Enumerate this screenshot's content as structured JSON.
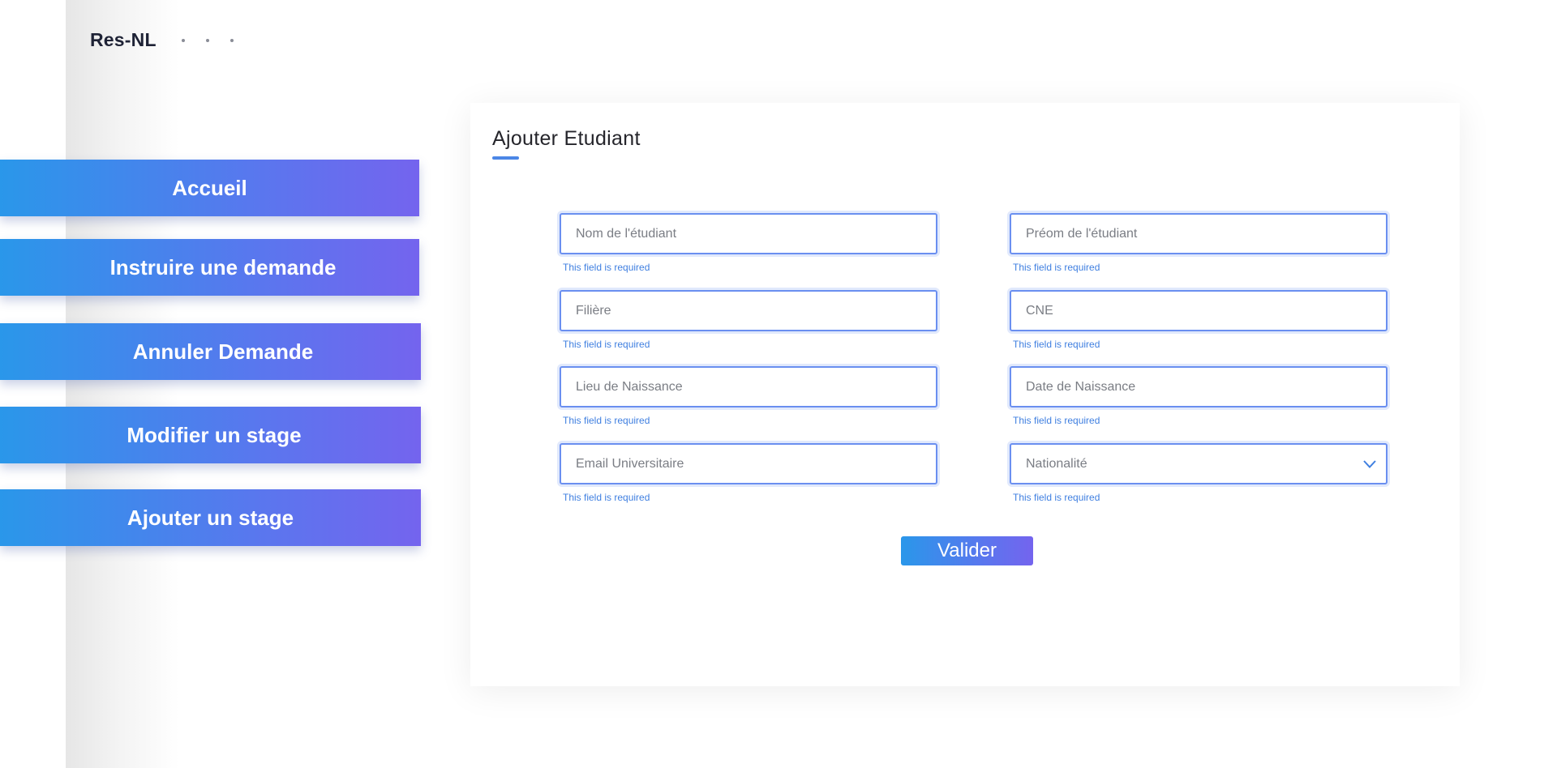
{
  "brand": "Res-NL",
  "nav": {
    "items": [
      {
        "label": "Accueil"
      },
      {
        "label": "Instruire une demande"
      },
      {
        "label": "Annuler Demande"
      },
      {
        "label": "Modifier un stage"
      },
      {
        "label": "Ajouter un stage"
      }
    ]
  },
  "form": {
    "title": "Ajouter Etudiant",
    "fields": [
      {
        "placeholder": "Nom de l'étudiant",
        "error": "This field is required"
      },
      {
        "placeholder": "Préom de l'étudiant",
        "error": "This field is required"
      },
      {
        "placeholder": "Filière",
        "error": "This field is required"
      },
      {
        "placeholder": "CNE",
        "error": "This field is required"
      },
      {
        "placeholder": "Lieu de Naissance",
        "error": "This field is required"
      },
      {
        "placeholder": "Date de Naissance",
        "error": "This field is required"
      },
      {
        "placeholder": "Email Universitaire",
        "error": "This field is required"
      },
      {
        "selected": "Nationalité",
        "error": "This field is required"
      }
    ],
    "submit_label": "Valider"
  },
  "icons": {
    "menu": "more-dots-icon",
    "select": "chevron-down-icon"
  },
  "colors": {
    "accent_start": "#2a97ea",
    "accent_end": "#7464ee",
    "field_border": "#6a8ff0",
    "error_text": "#3f7fe0"
  }
}
